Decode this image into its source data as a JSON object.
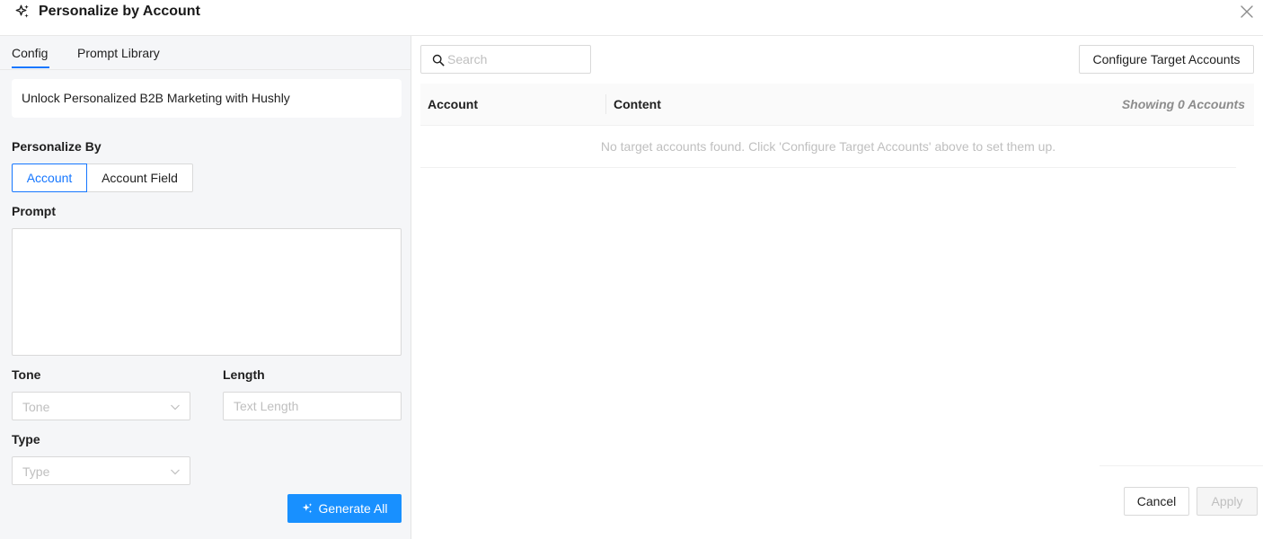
{
  "modal": {
    "title": "Personalize by Account",
    "title_icon": "sparkle-icon",
    "close_icon": "close-icon"
  },
  "left_panel": {
    "tabs": [
      {
        "label": "Config",
        "active": true
      },
      {
        "label": "Prompt Library",
        "active": false
      }
    ],
    "banner_text": "Unlock Personalized B2B Marketing with Hushly",
    "personalize_by": {
      "label": "Personalize By",
      "options": [
        "Account",
        "Account Field"
      ],
      "selected": "Account"
    },
    "prompt": {
      "label": "Prompt",
      "value": ""
    },
    "tone": {
      "label": "Tone",
      "placeholder": "Tone"
    },
    "length": {
      "label": "Length",
      "placeholder": "Text Length"
    },
    "type": {
      "label": "Type",
      "placeholder": "Type"
    },
    "generate_button": "Generate All"
  },
  "right_panel": {
    "search": {
      "placeholder": "Search",
      "value": ""
    },
    "configure_button": "Configure Target Accounts",
    "table": {
      "columns": [
        "Account",
        "Content"
      ],
      "showing_text": "Showing 0 Accounts",
      "empty_text": "No target accounts found. Click 'Configure Target Accounts' above to set them up."
    },
    "cancel_button": "Cancel",
    "apply_button": "Apply"
  },
  "colors": {
    "primary": "#1890ff",
    "panel_bg": "#f5f6f8",
    "muted": "#bfbfbf"
  }
}
